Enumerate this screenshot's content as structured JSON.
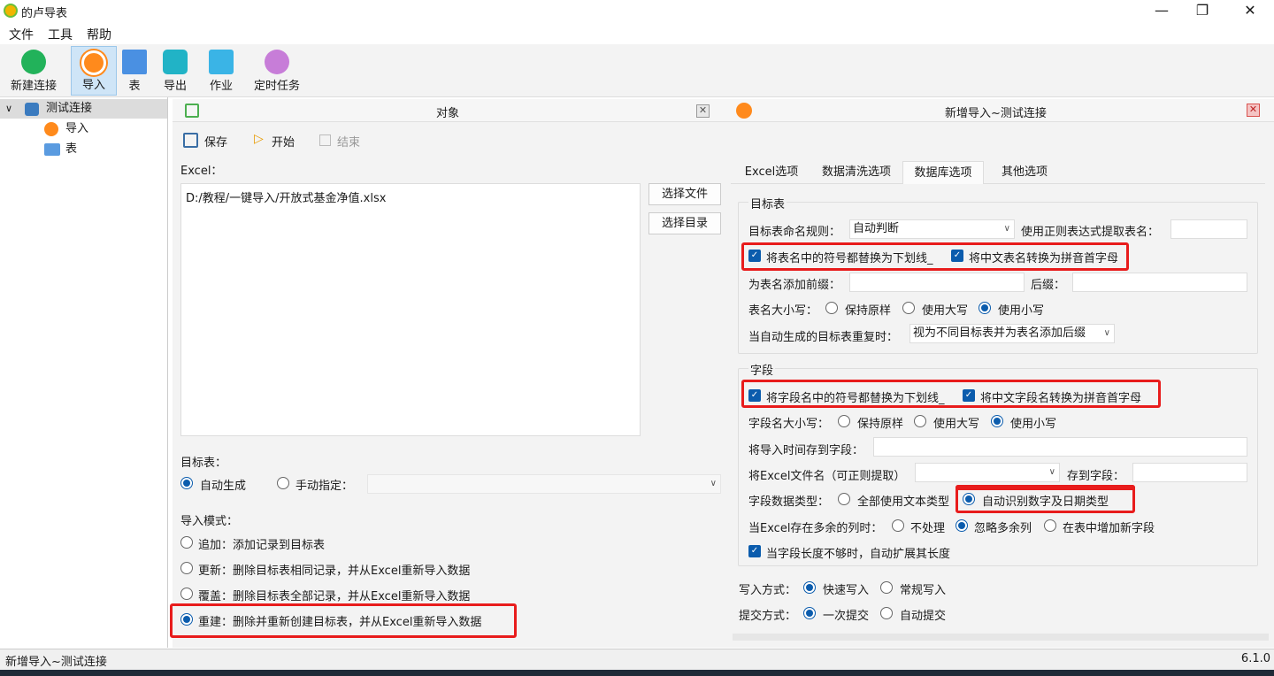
{
  "app": {
    "title": "的卢导表"
  },
  "menu": [
    "文件",
    "工具",
    "帮助"
  ],
  "toolbar": {
    "new_conn": "新建连接",
    "import": "导入",
    "table": "表",
    "export": "导出",
    "job": "作业",
    "schedule": "定时任务"
  },
  "tree": {
    "root": "测试连接",
    "children": [
      "导入",
      "表"
    ]
  },
  "objects": {
    "title": "对象",
    "save": "保存",
    "start": "开始",
    "end": "结束",
    "excel_label": "Excel：",
    "excel_path": "D:/教程/一键导入/开放式基金净值.xlsx",
    "choose_file": "选择文件",
    "choose_dir": "选择目录",
    "target_label": "目标表：",
    "target_auto": "自动生成",
    "target_manual": "手动指定：",
    "mode_label": "导入模式：",
    "modes": [
      "追加：添加记录到目标表",
      "更新：删除目标表相同记录，并从Excel重新导入数据",
      "覆盖：删除目标表全部记录，并从Excel重新导入数据",
      "重建：删除并重新创建目标表，并从Excel重新导入数据"
    ]
  },
  "wizard": {
    "title": "新增导入~测试连接",
    "tabs": [
      "Excel选项",
      "数据清洗选项",
      "数据库选项",
      "其他选项"
    ],
    "target_group": "目标表",
    "naming_rule_label": "目标表命名规则：",
    "naming_rule_value": "自动判断",
    "regex_label": "使用正则表达式提取表名：",
    "replace_symbols": "将表名中的符号都替换为下划线_",
    "pinyin_table": "将中文表名转换为拼音首字母",
    "prefix_label": "为表名添加前缀：",
    "suffix_label": "后缀：",
    "case_label": "表名大小写：",
    "case_options": [
      "保持原样",
      "使用大写",
      "使用小写"
    ],
    "dup_label": "当自动生成的目标表重复时：",
    "dup_value": "视为不同目标表并为表名添加后缀",
    "field_group": "字段",
    "field_replace": "将字段名中的符号都替换为下划线_",
    "field_pinyin": "将中文字段名转换为拼音首字母",
    "field_case_label": "字段名大小写：",
    "field_case_options": [
      "保持原样",
      "使用大写",
      "使用小写"
    ],
    "import_time_label": "将导入时间存到字段：",
    "filename_label": "将Excel文件名（可正则提取）",
    "store_label": "存到字段：",
    "type_label": "字段数据类型：",
    "type_options": [
      "全部使用文本类型",
      "自动识别数字及日期类型"
    ],
    "extra_cols_label": "当Excel存在多余的列时：",
    "extra_cols_options": [
      "不处理",
      "忽略多余列",
      "在表中增加新字段"
    ],
    "expand_len": "当字段长度不够时，自动扩展其长度",
    "write_label": "写入方式：",
    "write_options": [
      "快速写入",
      "常规写入"
    ],
    "commit_label": "提交方式：",
    "commit_options": [
      "一次提交",
      "自动提交"
    ]
  },
  "status": {
    "left": "新增导入~测试连接",
    "version": "6.1.0"
  }
}
